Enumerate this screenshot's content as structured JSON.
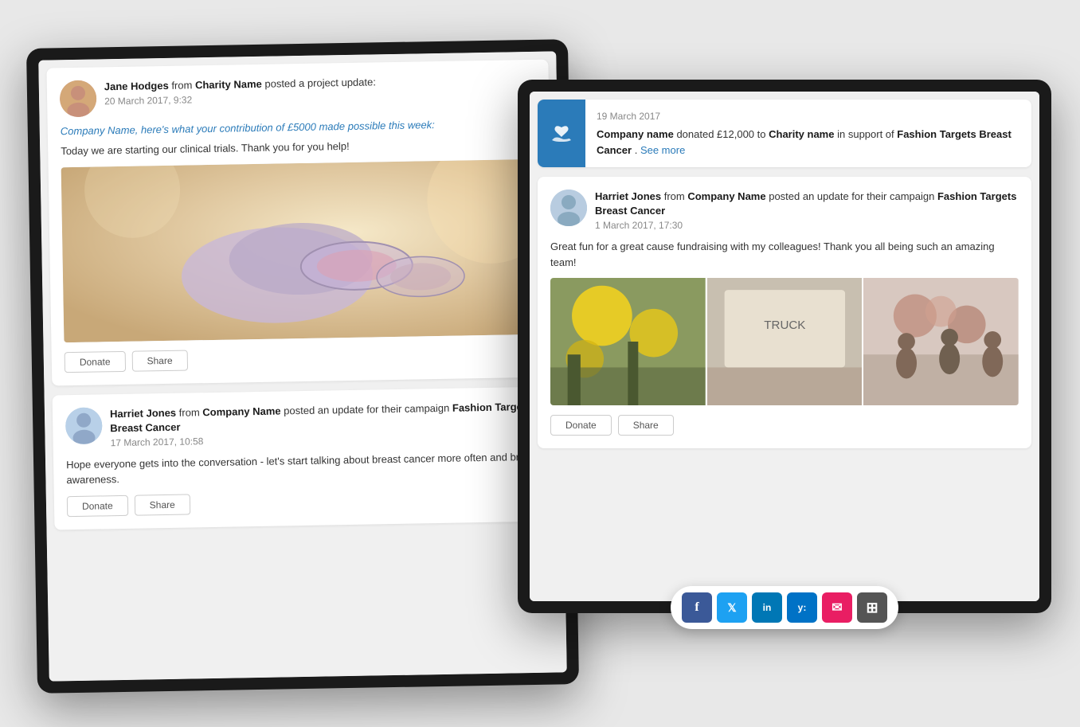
{
  "left_panel": {
    "post1": {
      "author": "Jane Hodges",
      "from_text": "from",
      "org": "Charity Name",
      "action": "posted a project update:",
      "date": "20 March 2017, 9:32",
      "highlight": "Company Name, here's what your contribution of £5000 made possible this week:",
      "body": "Today we are starting our clinical trials. Thank you for you help!",
      "donate_label": "Donate",
      "share_label": "Share"
    },
    "post2": {
      "author": "Harriet Jones",
      "from_text": "from",
      "org": "Company Name",
      "action": "posted an update for their campaign",
      "campaign": "Fashion Targets Breast Cancer",
      "date": "17 March 2017, 10:58",
      "body": "Hope everyone gets into the conversation - let's start talking about breast cancer more often and bring awareness.",
      "donate_label": "Donate",
      "share_label": "Share"
    }
  },
  "right_panel": {
    "donation": {
      "date": "19 March 2017",
      "text_pre": "Company name",
      "amount": "donated £12,000 to",
      "charity": "Charity name",
      "support_text": "in support of",
      "campaign": "Fashion Targets Breast Cancer",
      "see_more": "See more"
    },
    "post": {
      "author": "Harriet Jones",
      "from_text": "from",
      "org": "Company Name",
      "action": "posted an update for their campaign",
      "campaign": "Fashion Targets Breast Cancer",
      "date": "1 March 2017, 17:30",
      "body": "Great fun for a great cause fundraising with my colleagues! Thank you all being such an amazing team!",
      "donate_label": "Donate",
      "share_label": "Share"
    },
    "social_bar": {
      "facebook": "f",
      "twitter": "t",
      "linkedin": "in",
      "yammer": "y:",
      "email": "✉",
      "more": "⋯"
    }
  }
}
